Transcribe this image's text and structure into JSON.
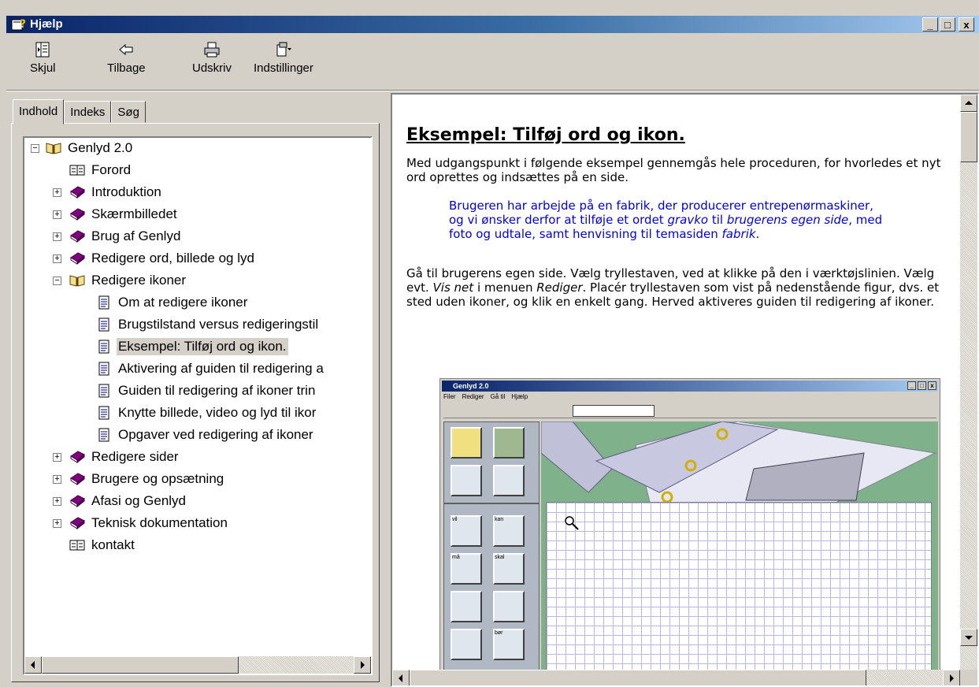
{
  "window": {
    "title": "Hjælp",
    "buttons": [
      "_",
      "□",
      "x"
    ]
  },
  "toolbar": {
    "hide_label": "Skjul",
    "back_label": "Tilbage",
    "print_label": "Udskriv",
    "options_label": "Indstillinger"
  },
  "tabs": [
    "Indhold",
    "Indeks",
    "Søg"
  ],
  "tree": {
    "root": "Genlyd 2.0",
    "items": [
      "Forord",
      "Introduktion",
      "Skærmbilledet",
      "Brug af Genlyd",
      "Redigere ord, billede og lyd",
      "Redigere ikoner",
      "Om at redigere ikoner",
      "Brugstilstand versus redigeringstil",
      "Eksempel: Tilføj ord og ikon.",
      "Aktivering af guiden til redigering a",
      "Guiden til redigering af ikoner trin",
      "Knytte billede, video og lyd til ikor",
      "Opgaver ved redigering af ikoner",
      "Redigere sider",
      "Brugere og opsætning",
      "Afasi og Genlyd",
      "Teknisk dokumentation",
      "kontakt"
    ],
    "selected": "Eksempel: Tilføj ord og ikon."
  },
  "content": {
    "heading": "Eksempel: Tilføj ord og ikon.",
    "intro": "Med udgangspunkt i følgende eksempel gennemgås hele proceduren, for hvorledes et nyt ord oprettes og indsættes på en side.",
    "example_1": "Brugeren har arbejde på en fabrik, der producerer entrepenørmaskiner, og vi ønsker derfor at tilføje et ordet ",
    "example_em1": "gravko",
    "example_2": " til ",
    "example_em2": "brugerens egen side",
    "example_3": ", med foto og udtale, samt henvisning til temasiden ",
    "example_em3": "fabrik",
    "example_4": ".",
    "step_1": "Gå til brugerens egen side. Vælg tryllestaven, ved at klikke på den i værktøjslinien. Vælg evt. ",
    "step_em1": "Vis net",
    "step_2": " i menuen ",
    "step_em2": "Rediger",
    "step_3": ". Placér tryllestaven som vist på nedenstående figur, dvs. et sted uden ikoner, og klik en enkelt gang. Herved aktiveres guiden til redigering af ikoner."
  },
  "figure": {
    "title": "Genlyd 2.0",
    "menu": [
      "Filer",
      "Rediger",
      "Gå til",
      "Hjælp"
    ],
    "cell_labels": [
      "vil",
      "kan",
      "må",
      "skal",
      "bør"
    ]
  },
  "colors": {
    "titlebar_start": "#0a246a",
    "titlebar_end": "#a6caf0",
    "example_text": "#0000e0",
    "grid_bg": "#7fb28a"
  }
}
